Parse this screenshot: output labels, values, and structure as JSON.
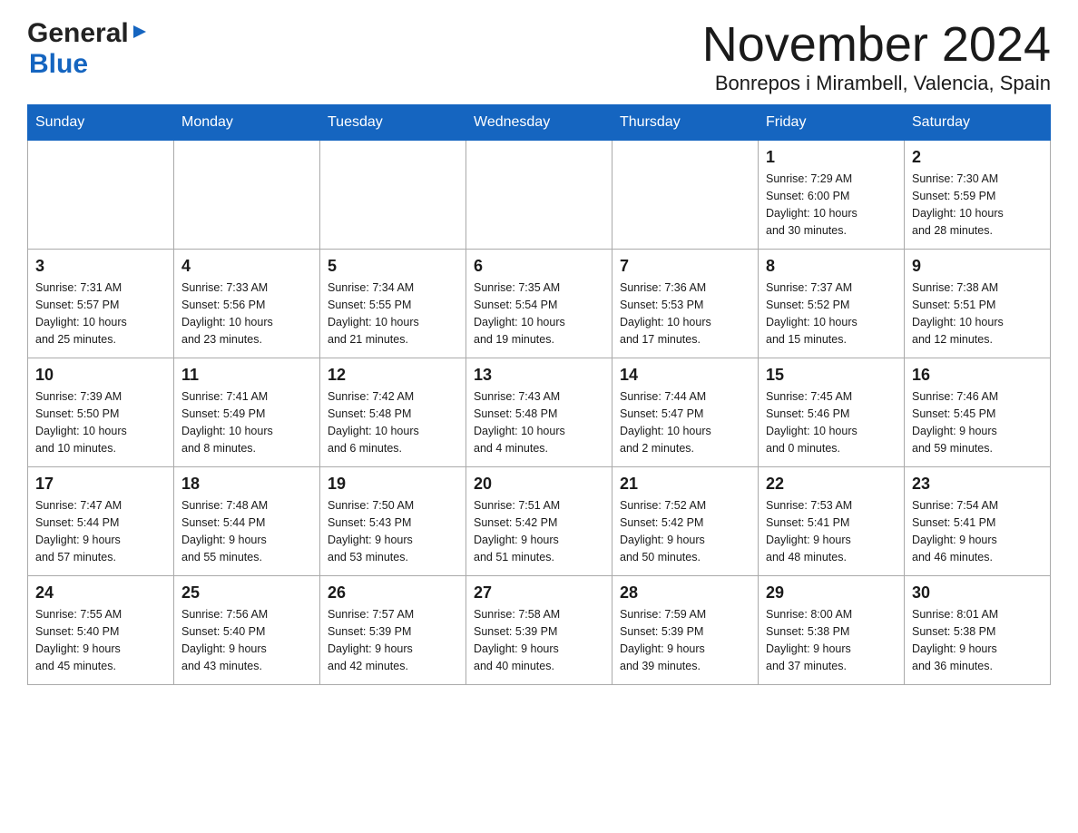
{
  "header": {
    "month_year": "November 2024",
    "location": "Bonrepos i Mirambell, Valencia, Spain",
    "logo_general": "General",
    "logo_blue": "Blue"
  },
  "days_of_week": [
    "Sunday",
    "Monday",
    "Tuesday",
    "Wednesday",
    "Thursday",
    "Friday",
    "Saturday"
  ],
  "weeks": [
    {
      "days": [
        {
          "number": "",
          "info": ""
        },
        {
          "number": "",
          "info": ""
        },
        {
          "number": "",
          "info": ""
        },
        {
          "number": "",
          "info": ""
        },
        {
          "number": "",
          "info": ""
        },
        {
          "number": "1",
          "info": "Sunrise: 7:29 AM\nSunset: 6:00 PM\nDaylight: 10 hours\nand 30 minutes."
        },
        {
          "number": "2",
          "info": "Sunrise: 7:30 AM\nSunset: 5:59 PM\nDaylight: 10 hours\nand 28 minutes."
        }
      ]
    },
    {
      "days": [
        {
          "number": "3",
          "info": "Sunrise: 7:31 AM\nSunset: 5:57 PM\nDaylight: 10 hours\nand 25 minutes."
        },
        {
          "number": "4",
          "info": "Sunrise: 7:33 AM\nSunset: 5:56 PM\nDaylight: 10 hours\nand 23 minutes."
        },
        {
          "number": "5",
          "info": "Sunrise: 7:34 AM\nSunset: 5:55 PM\nDaylight: 10 hours\nand 21 minutes."
        },
        {
          "number": "6",
          "info": "Sunrise: 7:35 AM\nSunset: 5:54 PM\nDaylight: 10 hours\nand 19 minutes."
        },
        {
          "number": "7",
          "info": "Sunrise: 7:36 AM\nSunset: 5:53 PM\nDaylight: 10 hours\nand 17 minutes."
        },
        {
          "number": "8",
          "info": "Sunrise: 7:37 AM\nSunset: 5:52 PM\nDaylight: 10 hours\nand 15 minutes."
        },
        {
          "number": "9",
          "info": "Sunrise: 7:38 AM\nSunset: 5:51 PM\nDaylight: 10 hours\nand 12 minutes."
        }
      ]
    },
    {
      "days": [
        {
          "number": "10",
          "info": "Sunrise: 7:39 AM\nSunset: 5:50 PM\nDaylight: 10 hours\nand 10 minutes."
        },
        {
          "number": "11",
          "info": "Sunrise: 7:41 AM\nSunset: 5:49 PM\nDaylight: 10 hours\nand 8 minutes."
        },
        {
          "number": "12",
          "info": "Sunrise: 7:42 AM\nSunset: 5:48 PM\nDaylight: 10 hours\nand 6 minutes."
        },
        {
          "number": "13",
          "info": "Sunrise: 7:43 AM\nSunset: 5:48 PM\nDaylight: 10 hours\nand 4 minutes."
        },
        {
          "number": "14",
          "info": "Sunrise: 7:44 AM\nSunset: 5:47 PM\nDaylight: 10 hours\nand 2 minutes."
        },
        {
          "number": "15",
          "info": "Sunrise: 7:45 AM\nSunset: 5:46 PM\nDaylight: 10 hours\nand 0 minutes."
        },
        {
          "number": "16",
          "info": "Sunrise: 7:46 AM\nSunset: 5:45 PM\nDaylight: 9 hours\nand 59 minutes."
        }
      ]
    },
    {
      "days": [
        {
          "number": "17",
          "info": "Sunrise: 7:47 AM\nSunset: 5:44 PM\nDaylight: 9 hours\nand 57 minutes."
        },
        {
          "number": "18",
          "info": "Sunrise: 7:48 AM\nSunset: 5:44 PM\nDaylight: 9 hours\nand 55 minutes."
        },
        {
          "number": "19",
          "info": "Sunrise: 7:50 AM\nSunset: 5:43 PM\nDaylight: 9 hours\nand 53 minutes."
        },
        {
          "number": "20",
          "info": "Sunrise: 7:51 AM\nSunset: 5:42 PM\nDaylight: 9 hours\nand 51 minutes."
        },
        {
          "number": "21",
          "info": "Sunrise: 7:52 AM\nSunset: 5:42 PM\nDaylight: 9 hours\nand 50 minutes."
        },
        {
          "number": "22",
          "info": "Sunrise: 7:53 AM\nSunset: 5:41 PM\nDaylight: 9 hours\nand 48 minutes."
        },
        {
          "number": "23",
          "info": "Sunrise: 7:54 AM\nSunset: 5:41 PM\nDaylight: 9 hours\nand 46 minutes."
        }
      ]
    },
    {
      "days": [
        {
          "number": "24",
          "info": "Sunrise: 7:55 AM\nSunset: 5:40 PM\nDaylight: 9 hours\nand 45 minutes."
        },
        {
          "number": "25",
          "info": "Sunrise: 7:56 AM\nSunset: 5:40 PM\nDaylight: 9 hours\nand 43 minutes."
        },
        {
          "number": "26",
          "info": "Sunrise: 7:57 AM\nSunset: 5:39 PM\nDaylight: 9 hours\nand 42 minutes."
        },
        {
          "number": "27",
          "info": "Sunrise: 7:58 AM\nSunset: 5:39 PM\nDaylight: 9 hours\nand 40 minutes."
        },
        {
          "number": "28",
          "info": "Sunrise: 7:59 AM\nSunset: 5:39 PM\nDaylight: 9 hours\nand 39 minutes."
        },
        {
          "number": "29",
          "info": "Sunrise: 8:00 AM\nSunset: 5:38 PM\nDaylight: 9 hours\nand 37 minutes."
        },
        {
          "number": "30",
          "info": "Sunrise: 8:01 AM\nSunset: 5:38 PM\nDaylight: 9 hours\nand 36 minutes."
        }
      ]
    }
  ]
}
